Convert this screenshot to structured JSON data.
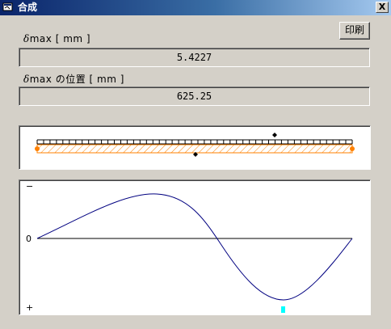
{
  "window": {
    "title": "合成",
    "close_label": "X"
  },
  "toolbar": {
    "print_label": "印刷"
  },
  "fields": {
    "dmax_label_symbol": "δ",
    "dmax_label_rest": "max [ mm ]",
    "dmax_value": "5.4227",
    "dmax_pos_label_symbol": "δ",
    "dmax_pos_label_rest": "max の位置 [ mm ]",
    "dmax_pos_value": "625.25"
  },
  "beam": {
    "beam_color": "#ff8000",
    "support_color": "#ff8000",
    "load_marker_color": "#000000"
  },
  "graph": {
    "minus_label": "−",
    "zero_label": "0",
    "plus_label": "+",
    "curve_color": "#000080",
    "max_marker_color": "#00ffff"
  }
}
